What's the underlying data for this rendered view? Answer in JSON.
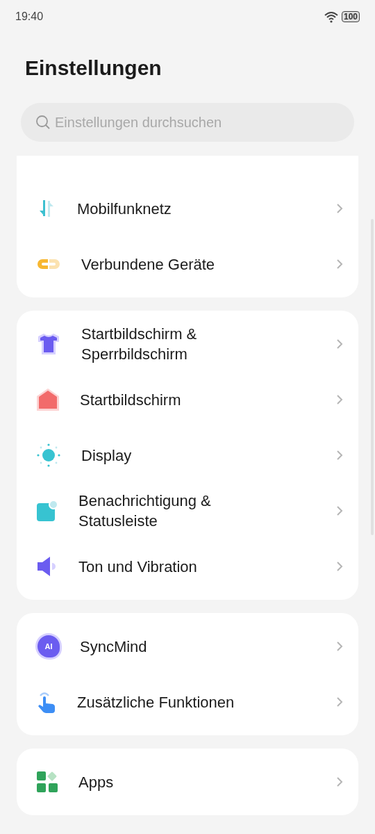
{
  "status_bar": {
    "time": "19:40",
    "battery": "100"
  },
  "title": "Einstellungen",
  "search": {
    "placeholder": "Einstellungen durchsuchen"
  },
  "groups": [
    {
      "cut_top": true,
      "items": [
        {
          "label": "Mobilfunknetz",
          "kind": "mobile"
        },
        {
          "label": "Verbundene Geräte",
          "kind": "link"
        }
      ]
    },
    {
      "cut_top": false,
      "items": [
        {
          "label": "Startbildschirm & Sperrbildschirm",
          "kind": "shirt"
        },
        {
          "label": "Startbildschirm",
          "kind": "home"
        },
        {
          "label": "Display",
          "kind": "sun"
        },
        {
          "label": "Benachrichtigung & Statusleiste",
          "kind": "notify"
        },
        {
          "label": "Ton und Vibration",
          "kind": "sound"
        }
      ]
    },
    {
      "cut_top": false,
      "items": [
        {
          "label": "SyncMind",
          "kind": "ai",
          "badge": "AI"
        },
        {
          "label": "Zusätzliche Funktionen",
          "kind": "touch"
        }
      ]
    },
    {
      "cut_top": false,
      "items": [
        {
          "label": "Apps",
          "kind": "apps"
        }
      ]
    }
  ]
}
